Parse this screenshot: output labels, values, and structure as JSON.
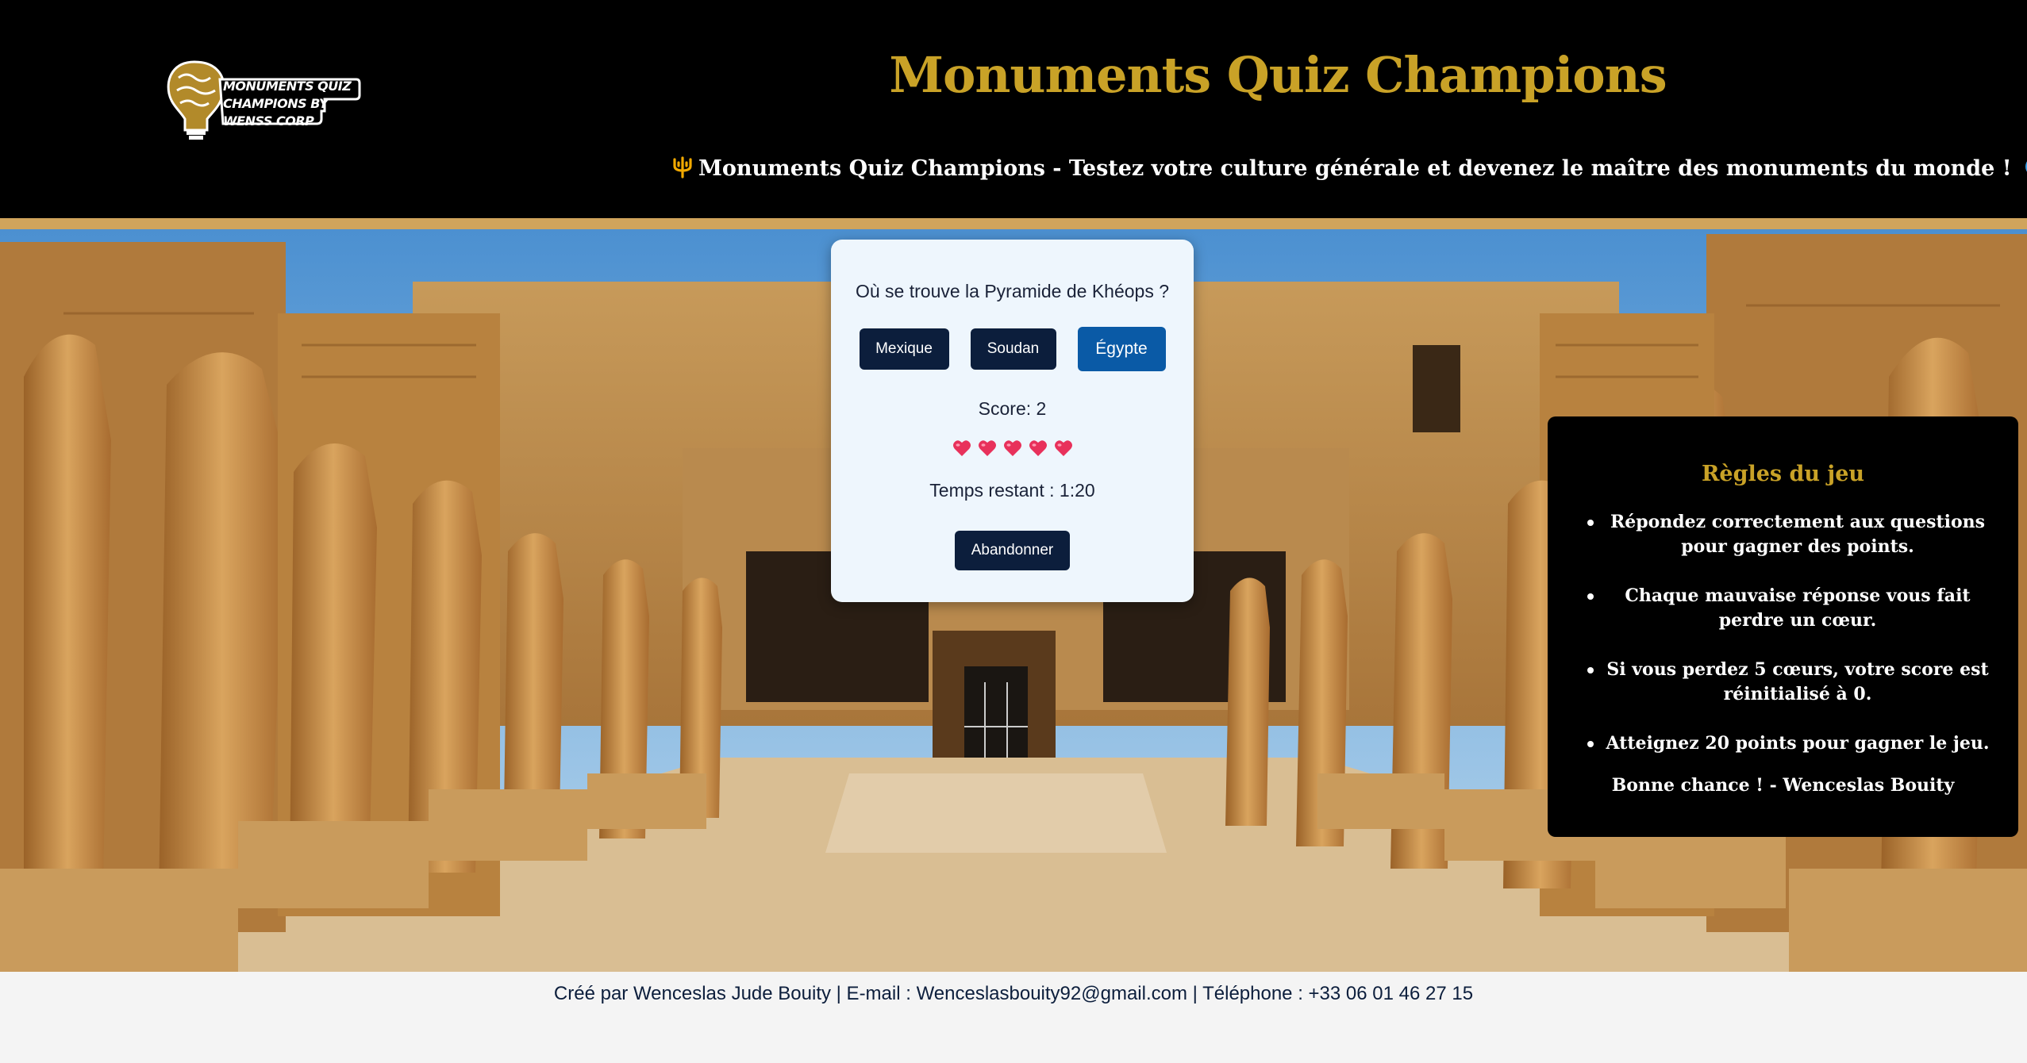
{
  "header": {
    "logo_text": "MONUMENTS QUIZ CHAMPIONS BY WENSS CORP",
    "title": "Monuments Quiz Champions",
    "tagline": "Monuments Quiz Champions - Testez votre culture générale et devenez le maître des monuments du monde !",
    "tagline_icons": [
      "trident-icon",
      "globe-icon",
      "sparkles-icon"
    ]
  },
  "quiz": {
    "question": "Où se trouve la Pyramide de Khéops ?",
    "answers": [
      "Mexique",
      "Soudan",
      "Égypte"
    ],
    "selected_answer": "Égypte",
    "score": "Score: 2",
    "hearts_remaining": 5,
    "timer": "Temps restant : 1:20",
    "quit_label": "Abandonner"
  },
  "rules": {
    "title": "Règles du jeu",
    "items": [
      "Répondez correctement aux questions pour gagner des points.",
      "Chaque mauvaise réponse vous fait perdre un cœur.",
      "Si vous perdez 5 cœurs, votre score est réinitialisé à 0.",
      "Atteignez 20 points pour gagner le jeu."
    ],
    "signature": "Bonne chance ! - Wenceslas Bouity"
  },
  "footer": {
    "text": "Créé par Wenceslas Jude Bouity | E-mail : Wenceslasbouity92@gmail.com | Téléphone : +33 06 01 46 27 15"
  },
  "colors": {
    "header_bg": "#000000",
    "gold": "#c9a227",
    "button_navy": "#0c1e3c",
    "button_selected": "#0a5aa6",
    "card_bg": "#eef6fd",
    "heart": "#e8315b"
  }
}
